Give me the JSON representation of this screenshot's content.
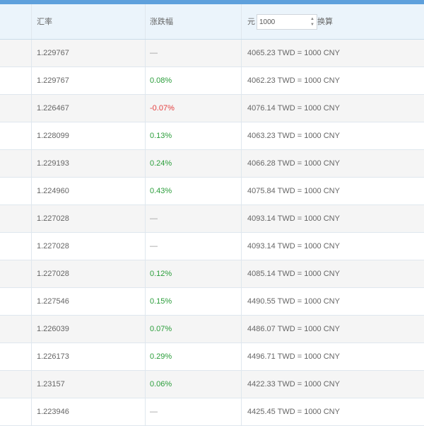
{
  "header": {
    "rate": "汇率",
    "change": "涨跌幅",
    "amount_prefix": "元",
    "amount_value": "1000",
    "amount_suffix": "换算"
  },
  "rows": [
    {
      "rate": "1.229767",
      "change": "—",
      "change_dir": "flat",
      "conversion": "4065.23 TWD = 1000 CNY"
    },
    {
      "rate": "1.229767",
      "change": "0.08%",
      "change_dir": "up",
      "conversion": "4062.23 TWD = 1000 CNY"
    },
    {
      "rate": "1.226467",
      "change": "-0.07%",
      "change_dir": "down",
      "conversion": "4076.14 TWD = 1000 CNY"
    },
    {
      "rate": "1.228099",
      "change": "0.13%",
      "change_dir": "up",
      "conversion": "4063.23 TWD = 1000 CNY"
    },
    {
      "rate": "1.229193",
      "change": "0.24%",
      "change_dir": "up",
      "conversion": "4066.28 TWD = 1000 CNY"
    },
    {
      "rate": "1.224960",
      "change": "0.43%",
      "change_dir": "up",
      "conversion": "4075.84 TWD = 1000 CNY"
    },
    {
      "rate": "1.227028",
      "change": "—",
      "change_dir": "flat",
      "conversion": "4093.14 TWD = 1000 CNY"
    },
    {
      "rate": "1.227028",
      "change": "—",
      "change_dir": "flat",
      "conversion": "4093.14 TWD = 1000 CNY"
    },
    {
      "rate": "1.227028",
      "change": "0.12%",
      "change_dir": "up",
      "conversion": "4085.14 TWD = 1000 CNY"
    },
    {
      "rate": "1.227546",
      "change": "0.15%",
      "change_dir": "up",
      "conversion": "4490.55 TWD = 1000 CNY"
    },
    {
      "rate": "1.226039",
      "change": "0.07%",
      "change_dir": "up",
      "conversion": "4486.07 TWD = 1000 CNY"
    },
    {
      "rate": "1.226173",
      "change": "0.29%",
      "change_dir": "up",
      "conversion": "4496.71 TWD = 1000 CNY"
    },
    {
      "rate": "1.23157",
      "change": "0.06%",
      "change_dir": "up",
      "conversion": "4422.33 TWD = 1000 CNY"
    },
    {
      "rate": "1.223946",
      "change": "—",
      "change_dir": "flat",
      "conversion": "4425.45 TWD = 1000 CNY"
    }
  ],
  "colors": {
    "up": "#2a9d3a",
    "down": "#e43d3d",
    "flat": "#999999",
    "header_bg": "#ebf4fb",
    "topbar": "#5ea0dc"
  }
}
